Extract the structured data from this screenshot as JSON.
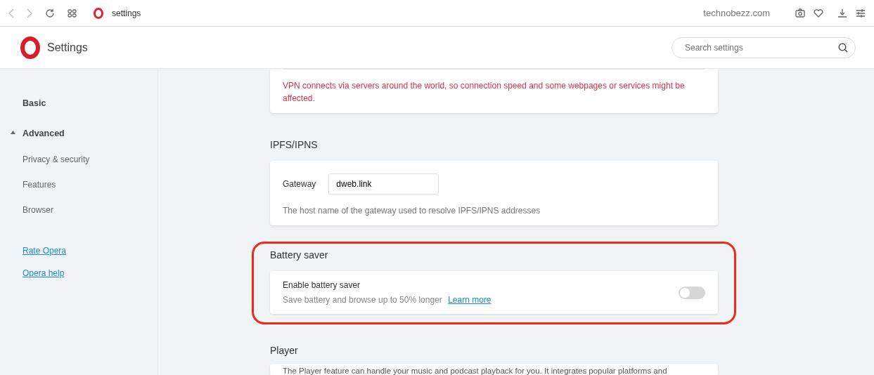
{
  "browser_bar": {
    "address": "settings",
    "site": "technobezz.com"
  },
  "header": {
    "title": "Settings",
    "search": {
      "placeholder": "Search settings"
    }
  },
  "sidebar": {
    "items": [
      {
        "label": "Basic"
      },
      {
        "label": "Advanced",
        "expanded": true,
        "children": [
          {
            "label": "Privacy & security"
          },
          {
            "label": "Features"
          },
          {
            "label": "Browser"
          }
        ]
      }
    ],
    "links": [
      "Rate Opera",
      "Opera help"
    ]
  },
  "vpn_card": {
    "warning": "VPN connects via servers around the world, so connection speed and some webpages or services might be affected."
  },
  "sections": [
    {
      "title": "IPFS/IPNS",
      "kind": "field",
      "label": "Gateway",
      "value": "dweb.link",
      "hint": "The host name of the gateway used to resolve IPFS/IPNS addresses",
      "highlighted": false
    },
    {
      "title": "Battery saver",
      "kind": "toggle",
      "label": "Enable battery saver",
      "hint": "Save battery and browse up to 50% longer",
      "link": "Learn more",
      "on": false,
      "highlighted": true
    },
    {
      "title": "Player",
      "kind": "text",
      "text": "The Player feature can handle your music and podcast playback for you. It integrates popular platforms and",
      "highlighted": false
    }
  ]
}
